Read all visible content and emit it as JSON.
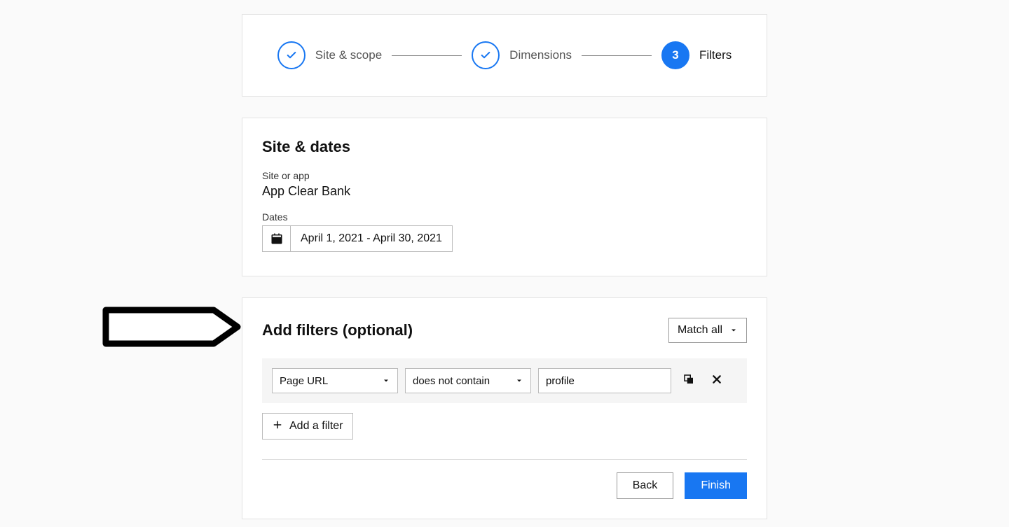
{
  "stepper": {
    "steps": [
      {
        "label": "Site & scope",
        "state": "done"
      },
      {
        "label": "Dimensions",
        "state": "done"
      },
      {
        "label": "Filters",
        "state": "active",
        "number": "3"
      }
    ]
  },
  "site": {
    "heading": "Site & dates",
    "site_label": "Site or app",
    "site_value": "App Clear Bank",
    "dates_label": "Dates",
    "dates_value": "April 1, 2021 - April 30, 2021"
  },
  "filters": {
    "heading": "Add filters (optional)",
    "match_label": "Match all",
    "row": {
      "field": "Page URL",
      "operator": "does not contain",
      "value": "profile"
    },
    "add_label": "Add a filter",
    "back_label": "Back",
    "finish_label": "Finish"
  }
}
